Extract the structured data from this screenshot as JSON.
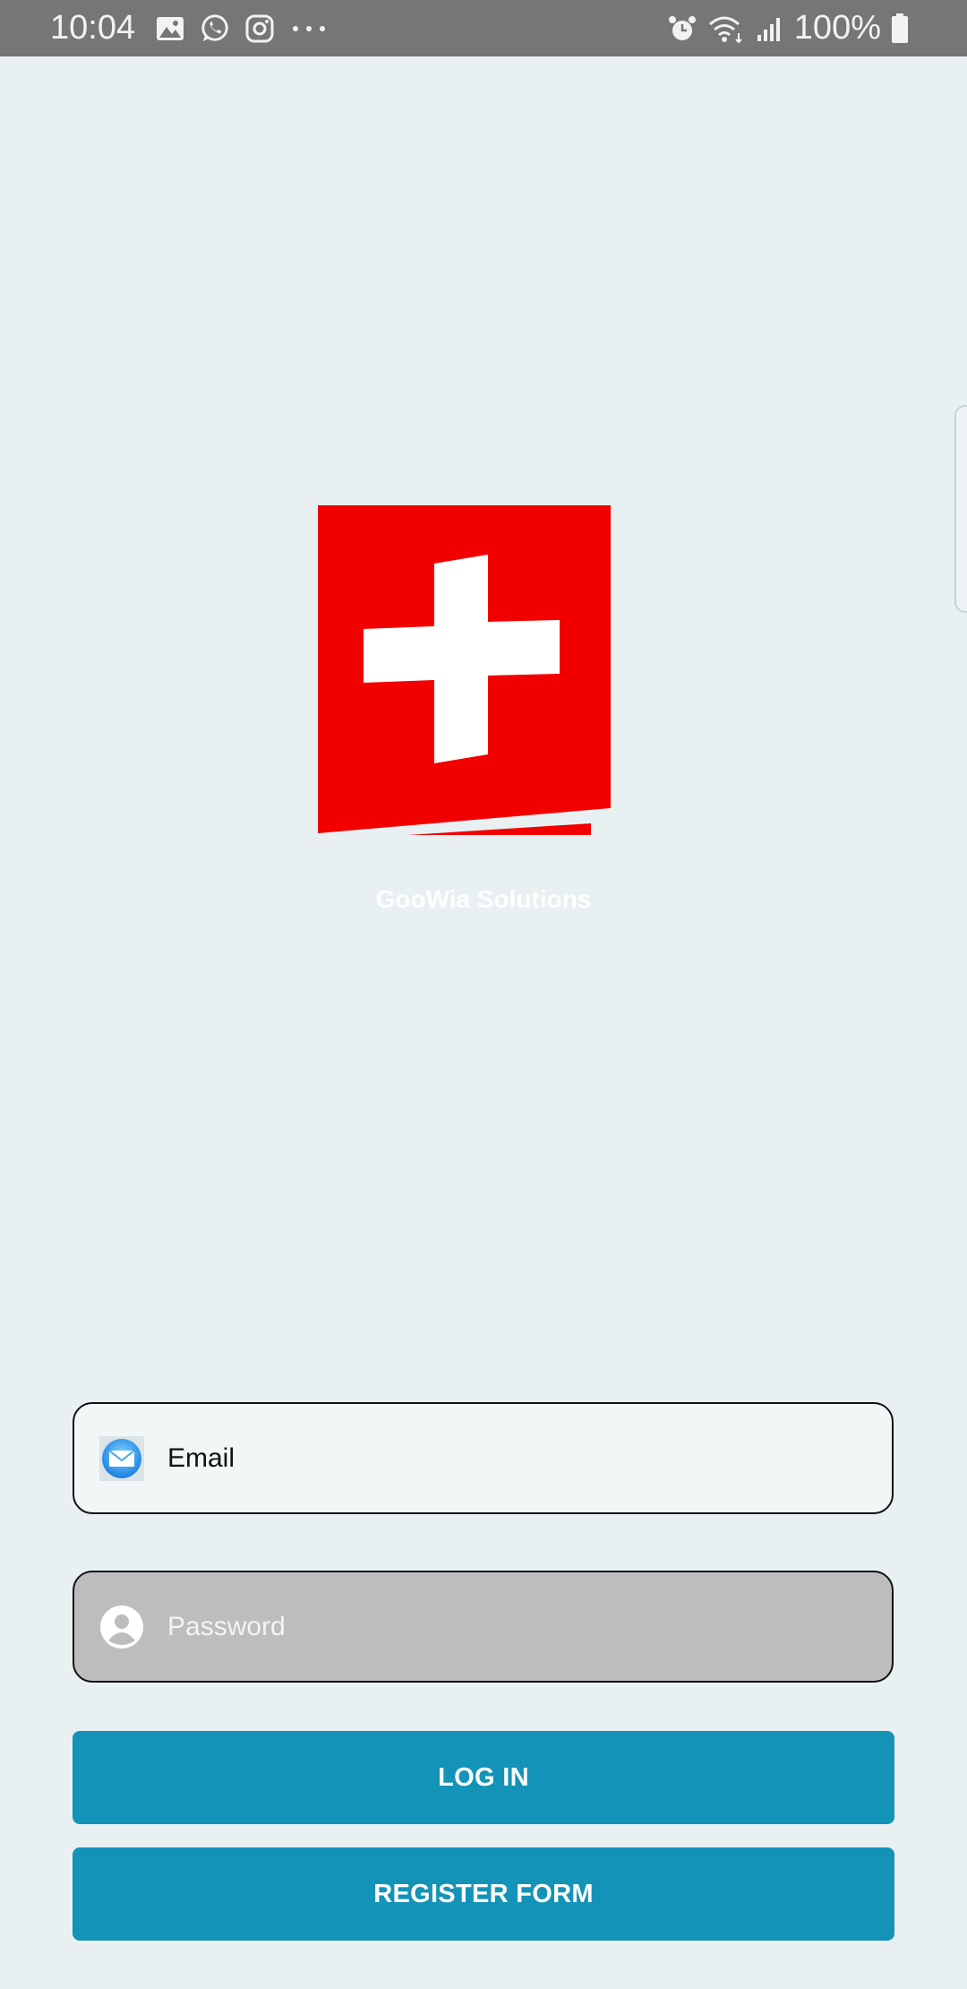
{
  "status_bar": {
    "time": "10:04",
    "battery": "100%",
    "left_icons": [
      "gallery-icon",
      "whatsapp-icon",
      "instagram-icon",
      "more-dots-icon"
    ],
    "right_icons": [
      "alarm-icon",
      "wifi-icon",
      "signal-icon",
      "battery-icon"
    ]
  },
  "brand": {
    "name": "GooWia Solutions",
    "logo": "swiss-cross-logo-icon",
    "logo_color": "#f20000"
  },
  "form": {
    "email": {
      "placeholder": "Email",
      "value": "",
      "icon": "mail-icon"
    },
    "password": {
      "placeholder": "Password",
      "value": "",
      "icon": "user-icon"
    }
  },
  "buttons": {
    "login": "LOG IN",
    "register": "REGISTER FORM"
  },
  "colors": {
    "background": "#e8f0f2",
    "button": "#1393b7",
    "status_bar": "#767676"
  }
}
